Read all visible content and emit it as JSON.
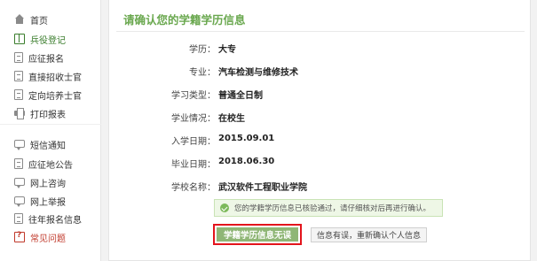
{
  "sidebar": {
    "items": [
      {
        "label": "首页",
        "icon": "home-icon"
      },
      {
        "label": "兵役登记",
        "icon": "book-icon",
        "active": true
      },
      {
        "label": "应征报名",
        "icon": "document-icon"
      },
      {
        "label": "直接招收士官",
        "icon": "document-icon"
      },
      {
        "label": "定向培养士官",
        "icon": "document-icon"
      },
      {
        "label": "打印报表",
        "icon": "printer-icon"
      },
      {
        "label": "短信通知",
        "icon": "chat-icon"
      },
      {
        "label": "应征地公告",
        "icon": "document-icon"
      },
      {
        "label": "网上咨询",
        "icon": "chat-icon"
      },
      {
        "label": "网上举报",
        "icon": "chat-icon"
      },
      {
        "label": "往年报名信息",
        "icon": "document-icon"
      },
      {
        "label": "常见问题",
        "icon": "question-icon"
      }
    ]
  },
  "main": {
    "title": "请确认您的学籍学历信息",
    "fields": [
      {
        "label": "学历：",
        "value": "大专"
      },
      {
        "label": "专业：",
        "value": "汽车检测与维修技术"
      },
      {
        "label": "学习类型：",
        "value": "普通全日制"
      },
      {
        "label": "学业情况：",
        "value": "在校生"
      },
      {
        "label": "入学日期：",
        "value": "2015.09.01"
      },
      {
        "label": "毕业日期：",
        "value": "2018.06.30"
      },
      {
        "label": "学校名称：",
        "value": "武汉软件工程职业学院"
      }
    ],
    "notice": "您的学籍学历信息已核验通过，请仔细核对后再进行确认。",
    "confirm_button": "学籍学历信息无误",
    "reconfirm_button": "信息有误，重新确认个人信息"
  },
  "colors": {
    "accent_green": "#6aa84f",
    "button_green": "#8fb676",
    "highlight_red": "#e3141c",
    "question_red": "#c0392b"
  }
}
